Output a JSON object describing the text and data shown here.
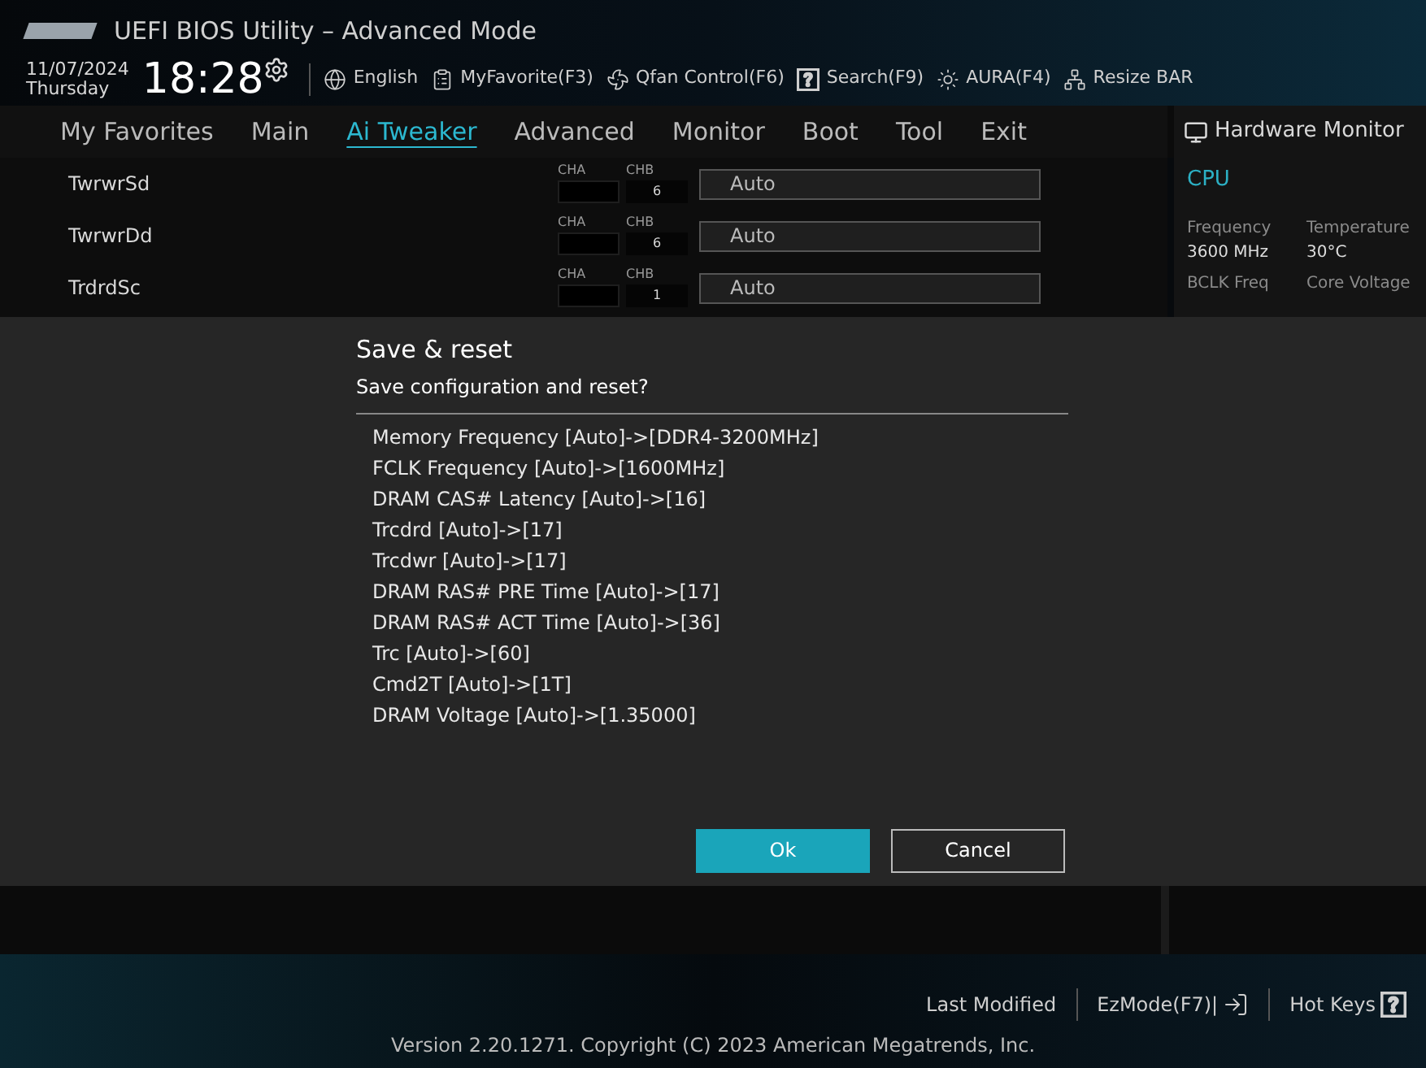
{
  "window": {
    "title": "UEFI BIOS Utility – Advanced Mode"
  },
  "clock": {
    "date": "11/07/2024",
    "day": "Thursday",
    "time": "18:28"
  },
  "toolbar": [
    {
      "label": "English"
    },
    {
      "label": "MyFavorite(F3)"
    },
    {
      "label": "Qfan Control(F6)"
    },
    {
      "label": "Search(F9)"
    },
    {
      "label": "AURA(F4)"
    },
    {
      "label": "Resize BAR"
    }
  ],
  "tabs": [
    {
      "label": "My Favorites",
      "selected": false
    },
    {
      "label": "Main",
      "selected": false
    },
    {
      "label": "Ai Tweaker",
      "selected": true
    },
    {
      "label": "Advanced",
      "selected": false
    },
    {
      "label": "Monitor",
      "selected": false
    },
    {
      "label": "Boot",
      "selected": false
    },
    {
      "label": "Tool",
      "selected": false
    },
    {
      "label": "Exit",
      "selected": false
    }
  ],
  "settings": [
    {
      "name": "TwrwrSd",
      "cha_label": "CHA",
      "chb_label": "CHB",
      "chb": "6",
      "value": "Auto"
    },
    {
      "name": "TwrwrDd",
      "cha_label": "CHA",
      "chb_label": "CHB",
      "chb": "6",
      "value": "Auto"
    },
    {
      "name": "TrdrdSc",
      "cha_label": "CHA",
      "chb_label": "CHB",
      "chb": "1",
      "value": "Auto"
    }
  ],
  "hardware_monitor": {
    "title": "Hardware Monitor",
    "section": "CPU",
    "readings": [
      {
        "label": "Frequency",
        "value": "3600 MHz"
      },
      {
        "label": "Temperature",
        "value": "30°C"
      },
      {
        "label": "BCLK Freq"
      },
      {
        "label": "Core Voltage"
      }
    ]
  },
  "dialog": {
    "title": "Save & reset",
    "message": "Save configuration and reset?",
    "changes": [
      "Memory Frequency [Auto]->[DDR4-3200MHz]",
      "FCLK Frequency [Auto]->[1600MHz]",
      "DRAM CAS# Latency [Auto]->[16]",
      "Trcdrd [Auto]->[17]",
      "Trcdwr [Auto]->[17]",
      "DRAM RAS# PRE Time [Auto]->[17]",
      "DRAM RAS# ACT Time [Auto]->[36]",
      "Trc [Auto]->[60]",
      "Cmd2T [Auto]->[1T]",
      "DRAM Voltage [Auto]->[1.35000]"
    ],
    "buttons": [
      {
        "label": "Ok",
        "kind": "primary"
      },
      {
        "label": "Cancel",
        "kind": "secondary"
      }
    ]
  },
  "footer": {
    "links": [
      {
        "label": "Last Modified"
      },
      {
        "label": "EzMode(F7)|"
      },
      {
        "label": "Hot Keys"
      }
    ],
    "version": "Version 2.20.1271. Copyright (C) 2023 American Megatrends, Inc."
  }
}
